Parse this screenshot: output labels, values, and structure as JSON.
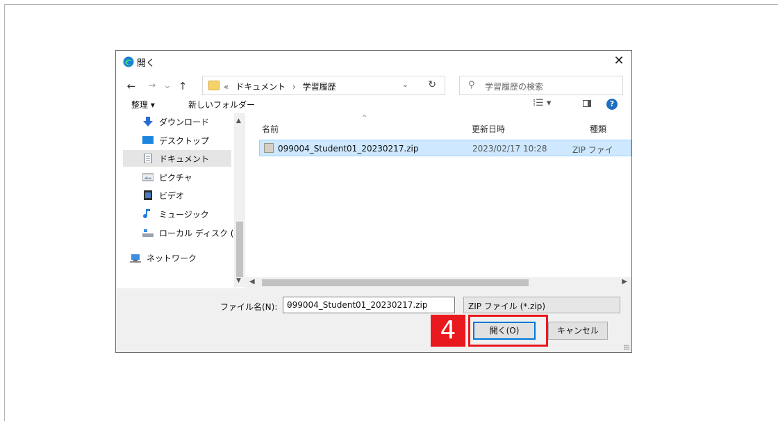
{
  "window": {
    "title": "開く",
    "close_glyph": "✕"
  },
  "nav": {
    "back": "←",
    "forward": "→",
    "recent": "⌄",
    "up": "↑"
  },
  "address": {
    "crumbs": [
      "«",
      "ドキュメント",
      "›",
      "学習履歴"
    ],
    "dropdown": "⌄",
    "refresh": "↻"
  },
  "search": {
    "icon": "⚲",
    "placeholder": "学習履歴の検索"
  },
  "toolbar": {
    "organize": "整理 ▾",
    "new_folder": "新しいフォルダー",
    "view": "⁞☰ ▾",
    "help": "?"
  },
  "sidebar": {
    "items": [
      {
        "label": "ダウンロード",
        "icon": "download-arrow-icon"
      },
      {
        "label": "デスクトップ",
        "icon": "desktop-icon"
      },
      {
        "label": "ドキュメント",
        "icon": "document-icon",
        "selected": true
      },
      {
        "label": "ピクチャ",
        "icon": "pictures-icon"
      },
      {
        "label": "ビデオ",
        "icon": "video-icon"
      },
      {
        "label": "ミュージック",
        "icon": "music-note-icon"
      },
      {
        "label": "ローカル ディスク (C",
        "icon": "local-disk-icon"
      },
      {
        "label": "ネットワーク",
        "icon": "network-icon"
      }
    ]
  },
  "columns": {
    "name": "名前",
    "modified": "更新日時",
    "type": "種類"
  },
  "files": [
    {
      "name": "099004_Student01_20230217.zip",
      "modified": "2023/02/17 10:28",
      "type": "ZIP ファイ"
    }
  ],
  "footer": {
    "filename_label": "ファイル名(N):",
    "filename_value": "099004_Student01_20230217.zip",
    "filetype": "ZIP ファイル (*.zip)",
    "open_label": "開く(O)",
    "cancel_label": "キャンセル"
  },
  "annotation": {
    "step": "4",
    "color": "#e8191e"
  },
  "colors": {
    "accent": "#0078d7",
    "selection": "#cde8ff"
  }
}
